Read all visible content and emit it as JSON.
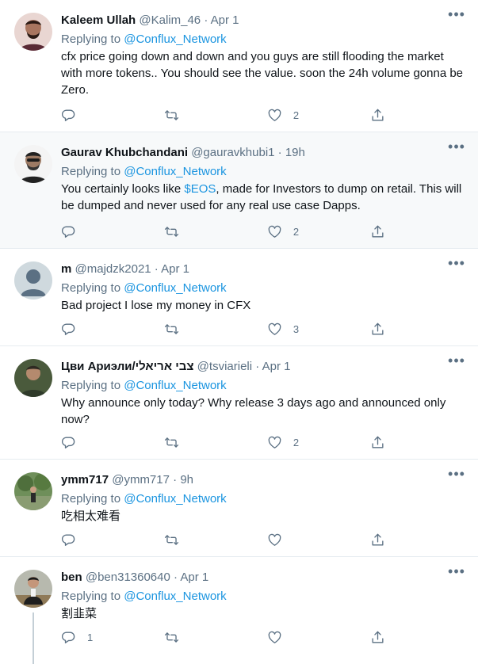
{
  "replying_label": "Replying to",
  "tweets": [
    {
      "name": "Kaleem Ullah",
      "handle": "@Kalim_46",
      "time": "Apr 1",
      "reply_to": "@Conflux_Network",
      "text": "cfx price going down and down and you guys are still flooding the market with more tokens.. You should see the value. soon the 24h volume gonna be Zero.",
      "like_count": "2"
    },
    {
      "name": "Gaurav Khubchandani",
      "handle": "@gauravkhubi1",
      "time": "19h",
      "reply_to": "@Conflux_Network",
      "text_before": "You certainly looks like ",
      "cashtag": "$EOS",
      "text_after": ", made for Investors to dump on retail. This will be dumped and never used for any real use case Dapps.",
      "like_count": "2"
    },
    {
      "name": "m",
      "handle": "@majdzk2021",
      "time": "Apr 1",
      "reply_to": "@Conflux_Network",
      "text": "Bad project I lose my money in CFX",
      "like_count": "3"
    },
    {
      "name": "Цви Ариэли/צבי אריאלי",
      "handle": "@tsviarieli",
      "time": "Apr 1",
      "reply_to": "@Conflux_Network",
      "text": "Why announce only today? Why release 3 days ago and announced only now?",
      "like_count": "2"
    },
    {
      "name": "ymm717",
      "handle": "@ymm717",
      "time": "9h",
      "reply_to": "@Conflux_Network",
      "text": "吃相太难看",
      "like_count": ""
    },
    {
      "name": "ben",
      "handle": "@ben31360640",
      "time": "Apr 1",
      "reply_to": "@Conflux_Network",
      "text": "割韭菜",
      "reply_count": "1",
      "like_count": ""
    }
  ],
  "colors": {
    "link": "#1b95e0",
    "secondary": "#5b7083",
    "divider": "#e6ecf0",
    "highlight_bg": "#f7f9fa"
  }
}
